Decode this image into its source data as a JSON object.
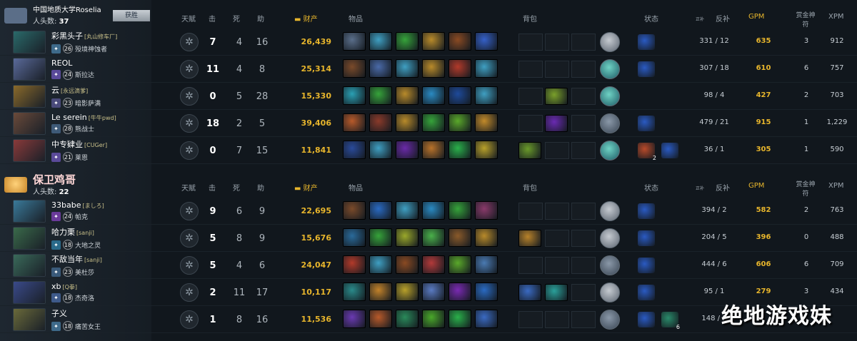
{
  "team1": {
    "name": "中国地质大学Roselia",
    "kills_label": "人头数:",
    "kills": "37",
    "badge": "获胜"
  },
  "team2": {
    "name": "保卫鸡哥",
    "kills_label": "人头数:",
    "kills": "22"
  },
  "headers": {
    "talent": "天赋",
    "k": "击",
    "d": "死",
    "a": "助",
    "networth": "财产",
    "items": "物品",
    "backpack": "背包",
    "status": "状态",
    "lh_small": "正补",
    "lh": "反补",
    "gpm": "GPM",
    "bounty": "赏金神符",
    "xpm": "XPM"
  },
  "team1_players": [
    {
      "name": "彩黑头子",
      "tag": "[丸山修车厂]",
      "level": "26",
      "hero": "殁境神蚀者",
      "k": "7",
      "d": "4",
      "a": "16",
      "networth": "26,439",
      "lh": "331",
      "dn": "12",
      "gpm": "635",
      "bounty": "3",
      "xpm": "912"
    },
    {
      "name": "REOL",
      "tag": "",
      "level": "24",
      "hero": "斯拉达",
      "k": "11",
      "d": "4",
      "a": "8",
      "networth": "25,314",
      "lh": "307",
      "dn": "18",
      "gpm": "610",
      "bounty": "6",
      "xpm": "757"
    },
    {
      "name": "云",
      "tag": "[永远滴爹]",
      "level": "23",
      "hero": "暗影萨满",
      "k": "0",
      "d": "5",
      "a": "28",
      "networth": "15,330",
      "lh": "98",
      "dn": "4",
      "gpm": "427",
      "bounty": "2",
      "xpm": "703"
    },
    {
      "name": "Le serein",
      "tag": "[牛牛pwd]",
      "level": "28",
      "hero": "熊战士",
      "k": "18",
      "d": "2",
      "a": "5",
      "networth": "39,406",
      "lh": "479",
      "dn": "21",
      "gpm": "915",
      "bounty": "1",
      "xpm": "1,229"
    },
    {
      "name": "中专肄业",
      "tag": "[CUGer]",
      "level": "21",
      "hero": "莱恩",
      "k": "0",
      "d": "7",
      "a": "15",
      "networth": "11,841",
      "lh": "36",
      "dn": "1",
      "gpm": "305",
      "bounty": "1",
      "xpm": "590"
    }
  ],
  "team2_players": [
    {
      "name": "33babe",
      "tag": "[ましろ]",
      "level": "24",
      "hero": "帕克",
      "k": "9",
      "d": "6",
      "a": "9",
      "networth": "22,695",
      "lh": "394",
      "dn": "2",
      "gpm": "582",
      "bounty": "2",
      "xpm": "763"
    },
    {
      "name": "哈力栗",
      "tag": "[sanji]",
      "level": "18",
      "hero": "大地之灵",
      "k": "5",
      "d": "8",
      "a": "9",
      "networth": "15,676",
      "lh": "204",
      "dn": "5",
      "gpm": "396",
      "bounty": "0",
      "xpm": "488"
    },
    {
      "name": "不敌当年",
      "tag": "[sanji]",
      "level": "23",
      "hero": "美杜莎",
      "k": "5",
      "d": "4",
      "a": "6",
      "networth": "24,047",
      "lh": "444",
      "dn": "6",
      "gpm": "606",
      "bounty": "6",
      "xpm": "709"
    },
    {
      "name": "xb",
      "tag": "[Q拳]",
      "level": "18",
      "hero": "杰奇洛",
      "k": "2",
      "d": "11",
      "a": "17",
      "networth": "10,117",
      "lh": "95",
      "dn": "1",
      "gpm": "279",
      "bounty": "3",
      "xpm": "434"
    },
    {
      "name": "子义",
      "tag": "",
      "level": "18",
      "hero": "痛苦女王",
      "k": "1",
      "d": "8",
      "a": "16",
      "networth": "11,536",
      "lh": "148",
      "dn": "2",
      "gpm": "",
      "bounty": "",
      "xpm": ""
    }
  ],
  "watermark": "绝地游戏妹",
  "colors": {
    "gold": "#e7b52c",
    "bg": "#11171d"
  }
}
